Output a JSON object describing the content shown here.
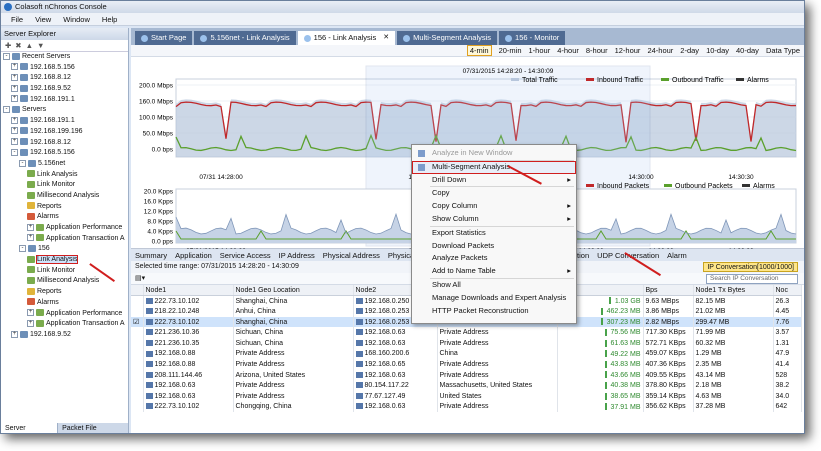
{
  "app": {
    "title": "Colasoft nChronos Console"
  },
  "menu": [
    "File",
    "View",
    "Window",
    "Help"
  ],
  "explorer": {
    "title": "Server Explorer",
    "tree": [
      {
        "label": "Recent Servers",
        "lvl": 0,
        "pm": "-"
      },
      {
        "label": "192.168.5.156",
        "lvl": 1,
        "pm": "+"
      },
      {
        "label": "192.168.8.12",
        "lvl": 1,
        "pm": "+"
      },
      {
        "label": "192.168.9.52",
        "lvl": 1,
        "pm": "+"
      },
      {
        "label": "192.168.191.1",
        "lvl": 1,
        "pm": "+"
      },
      {
        "label": "Servers",
        "lvl": 0,
        "pm": "-"
      },
      {
        "label": "192.168.191.1",
        "lvl": 1,
        "pm": "+"
      },
      {
        "label": "192.168.199.196",
        "lvl": 1,
        "pm": "+"
      },
      {
        "label": "192.168.8.12",
        "lvl": 1,
        "pm": "+"
      },
      {
        "label": "192.168.5.156",
        "lvl": 1,
        "pm": "-"
      },
      {
        "label": "5.156net",
        "lvl": 2,
        "pm": "-"
      },
      {
        "label": "Link Analysis",
        "lvl": 3,
        "pm": ""
      },
      {
        "label": "Link Monitor",
        "lvl": 3,
        "pm": ""
      },
      {
        "label": "Millisecond Analysis",
        "lvl": 3,
        "pm": ""
      },
      {
        "label": "Reports",
        "lvl": 3,
        "pm": ""
      },
      {
        "label": "Alarms",
        "lvl": 3,
        "pm": ""
      },
      {
        "label": "Application Performance",
        "lvl": 3,
        "pm": "+"
      },
      {
        "label": "Application Transaction A",
        "lvl": 3,
        "pm": "+"
      },
      {
        "label": "156",
        "lvl": 2,
        "pm": "-"
      },
      {
        "label": "Link Analysis",
        "lvl": 3,
        "pm": "",
        "sel": true
      },
      {
        "label": "Link Monitor",
        "lvl": 3,
        "pm": ""
      },
      {
        "label": "Millisecond Analysis",
        "lvl": 3,
        "pm": ""
      },
      {
        "label": "Reports",
        "lvl": 3,
        "pm": ""
      },
      {
        "label": "Alarms",
        "lvl": 3,
        "pm": ""
      },
      {
        "label": "Application Performance",
        "lvl": 3,
        "pm": "+"
      },
      {
        "label": "Application Transaction A",
        "lvl": 3,
        "pm": "+"
      },
      {
        "label": "192.168.9.52",
        "lvl": 1,
        "pm": "+"
      }
    ],
    "bottom_tabs": [
      "Server Explorer",
      "Packet File Explorer"
    ]
  },
  "doc_tabs": [
    {
      "label": "Start Page"
    },
    {
      "label": "5.156net - Link Analysis"
    },
    {
      "label": "156 - Link Analysis",
      "active": true
    },
    {
      "label": "Multi-Segment Analysis"
    },
    {
      "label": "156 - Monitor"
    }
  ],
  "time_ranges": [
    "4-min",
    "20-min",
    "1-hour",
    "4-hour",
    "8-hour",
    "12-hour",
    "24-hour",
    "2-day",
    "10-day",
    "40-day"
  ],
  "time_active": "4-min",
  "data_type": "Data Type",
  "chart1": {
    "title": "07/31/2015 14:28:20 - 14:30:09",
    "legend": [
      "Total Traffic",
      "Inbound Traffic",
      "Outbound Traffic",
      "Alarms"
    ],
    "yticks": [
      "200.0 Mbps",
      "160.0 Mbps",
      "100.0 Mbps",
      "50.0 Mbps",
      "0.0 bps"
    ],
    "xticks": [
      "07/31 14:28:00",
      "14:28:30",
      "14:30:00",
      "14:30:30"
    ]
  },
  "chart2": {
    "legend": [
      "Inbound Packets",
      "Outbound Packets",
      "Alarms"
    ],
    "yticks": [
      "20.0 Kpps",
      "16.0 Kpps",
      "12.0 Kpps",
      "8.0 Kpps",
      "4.0 Kpps",
      "0.0 pps"
    ],
    "xticks": [
      "07/31/2015 14:28:00",
      "14:28:30",
      "14:29:30",
      "14:30:00",
      "14:30:30"
    ]
  },
  "analysis_tabs": [
    "Summary",
    "Application",
    "Service Access",
    "IP Address",
    "Physical Address",
    "Physical Conve",
    "N",
    "IP Conversation",
    "TCP Conversation",
    "UDP Conversation",
    "Alarm"
  ],
  "analysis_active": "IP Conversation",
  "range_text": "Selected time range: 07/31/2015  14:28:20 - 14:30:09",
  "ip_conv_button": "IP Conversation[1000/1000]",
  "search_placeholder": "Search IP Conversation",
  "table": {
    "headers": [
      "",
      "Node1",
      "Node1 Geo Location",
      "Node2",
      "",
      "",
      "Bps",
      "Node1 Tx Bytes",
      "Noc"
    ],
    "rows": [
      [
        "222.73.10.102",
        "Shanghai, China",
        "192.168.0.250",
        "",
        "1.03 GB",
        "9.63 MBps",
        "82.15 MB",
        "26.3"
      ],
      [
        "218.22.10.248",
        "Anhui, China",
        "192.168.0.253",
        "",
        "462.23 MB",
        "3.86 MBps",
        "21.02 MB",
        "4.45"
      ],
      [
        "222.73.10.102",
        "Shanghai, China",
        "192.168.0.253",
        "Private Address",
        "307.23 MB",
        "2.82 MBps",
        "299.47 MB",
        "7.76"
      ],
      [
        "221.236.10.36",
        "Sichuan, China",
        "192.168.0.63",
        "Private Address",
        "75.56 MB",
        "717.30 KBps",
        "71.99 MB",
        "3.57"
      ],
      [
        "221.236.10.35",
        "Sichuan, China",
        "192.168.0.63",
        "Private Address",
        "61.63 MB",
        "572.71 KBps",
        "60.32 MB",
        "1.31"
      ],
      [
        "192.168.0.88",
        "Private Address",
        "168.160.200.6",
        "China",
        "49.22 MB",
        "459.07 KBps",
        "1.29 MB",
        "47.9"
      ],
      [
        "192.168.0.88",
        "Private Address",
        "192.168.0.65",
        "Private Address",
        "43.83 MB",
        "407.36 KBps",
        "2.35 MB",
        "41.4"
      ],
      [
        "208.111.144.46",
        "Arizona, United States",
        "192.168.0.63",
        "Private Address",
        "43.66 MB",
        "409.55 KBps",
        "43.14 MB",
        "528"
      ],
      [
        "192.168.0.63",
        "Private Address",
        "80.154.117.22",
        "Massachusetts, United States",
        "40.38 MB",
        "378.80 KBps",
        "2.18 MB",
        "38.2"
      ],
      [
        "192.168.0.63",
        "Private Address",
        "77.67.127.49",
        "United States",
        "38.65 MB",
        "359.14 KBps",
        "4.63 MB",
        "34.0"
      ],
      [
        "222.73.10.102",
        "Chongqing, China",
        "192.168.0.63",
        "Private Address",
        "37.91 MB",
        "356.62 KBps",
        "37.28 MB",
        "642"
      ]
    ]
  },
  "context_menu": [
    {
      "label": "Analyze in New Window",
      "disabled": true
    },
    {
      "sep": true
    },
    {
      "label": "Multi-Segment Analysis",
      "sel": true
    },
    {
      "label": "Drill Down",
      "sub": true
    },
    {
      "sep": true
    },
    {
      "label": "Copy"
    },
    {
      "label": "Copy Column",
      "sub": true
    },
    {
      "label": "Show Column",
      "sub": true
    },
    {
      "sep": true
    },
    {
      "label": "Export Statistics"
    },
    {
      "label": "Download Packets"
    },
    {
      "label": "Analyze Packets"
    },
    {
      "label": "Add to Name Table",
      "sub": true
    },
    {
      "sep": true
    },
    {
      "label": "Show All"
    },
    {
      "label": "Manage Downloads and Expert Analysis"
    },
    {
      "label": "HTTP Packet Reconstruction"
    }
  ],
  "colors": {
    "inbound": "#c0282a",
    "outbound": "#5aa02c",
    "total": "#b7c6dc",
    "accent": "#d01e1e"
  }
}
